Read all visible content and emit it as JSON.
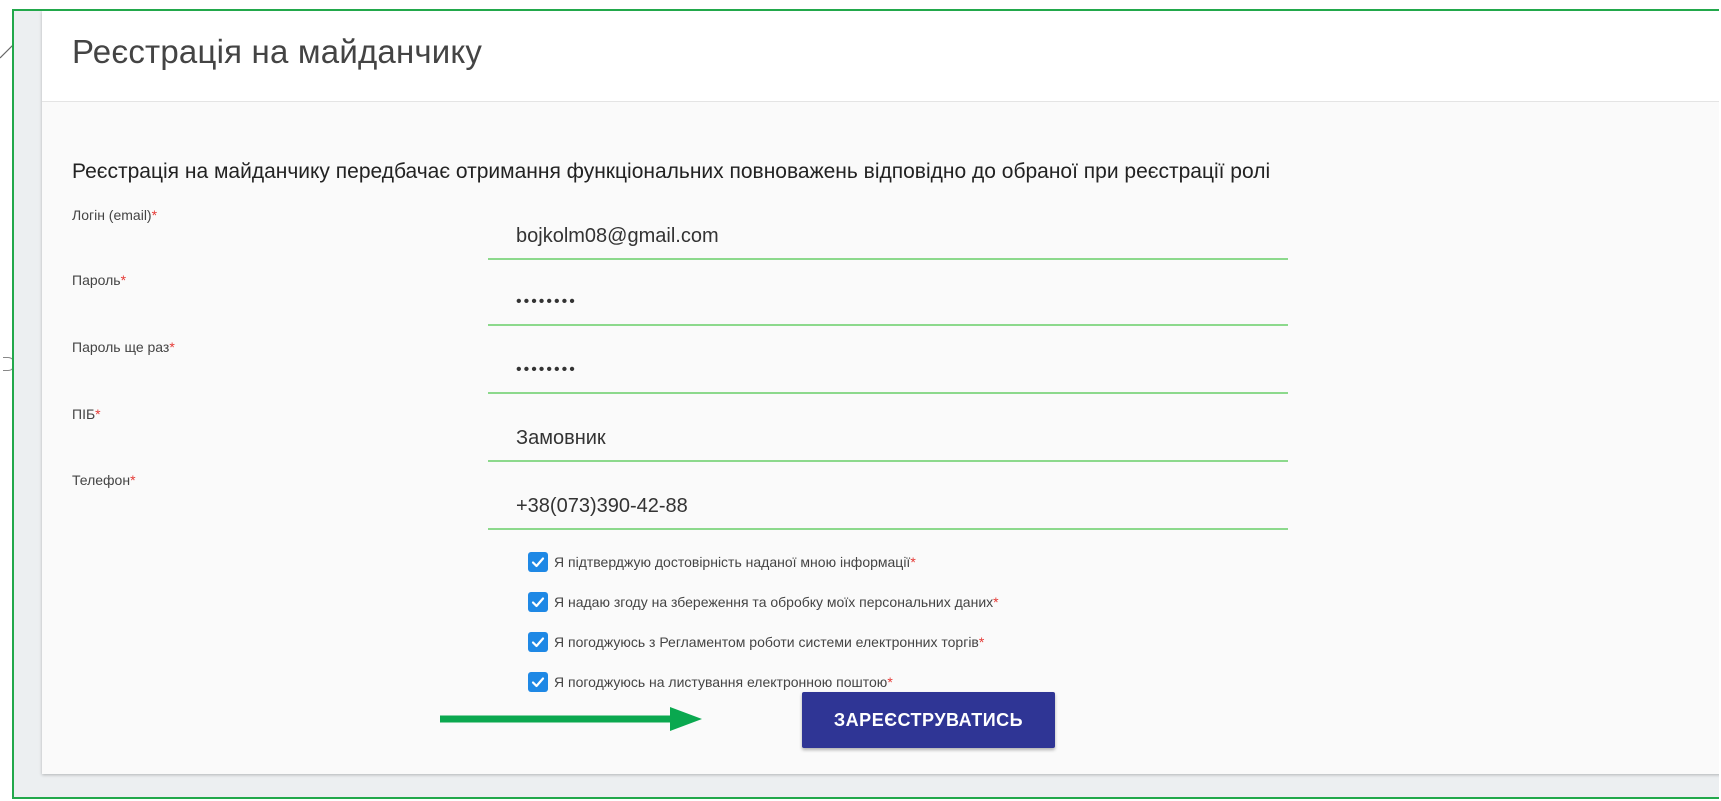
{
  "header": {
    "title": "Реєстрація на майданчику"
  },
  "form": {
    "intro": "Реєстрація на майданчику передбачає отримання функціональних повноважень відповідно до обраної при реєстрації ролі",
    "fields": [
      {
        "label": "Логін (email)",
        "required_mark": "*",
        "value": "bojkolm08@gmail.com"
      },
      {
        "label": "Пароль",
        "required_mark": "*",
        "value": "••••••••"
      },
      {
        "label": "Пароль ще раз",
        "required_mark": "*",
        "value": "••••••••"
      },
      {
        "label": "ПІБ",
        "required_mark": "*",
        "value": "Замовник"
      },
      {
        "label": "Телефон",
        "required_mark": "*",
        "value": "+38(073)390-42-88"
      }
    ],
    "checkboxes": [
      {
        "label": "Я підтверджую достовірність наданої мною інформації",
        "required_mark": "*",
        "checked": true
      },
      {
        "label": "Я надаю згоду на збереження та обробку моїх персональних даних",
        "required_mark": "*",
        "checked": true
      },
      {
        "label": "Я погоджуюсь з Регламентом роботи системи електронних торгів",
        "required_mark": "*",
        "checked": true
      },
      {
        "label": "Я погоджуюсь на листування електронною поштою",
        "required_mark": "*",
        "checked": true
      }
    ],
    "register_label": "ЗАРЕЄСТРУВАТИСЬ"
  },
  "icons": {
    "checkbox": "check-icon",
    "arrow": "arrow-right-icon"
  },
  "colors": {
    "frame_border": "#22a84b",
    "button_bg": "#2f3595",
    "input_underline": "#8cd98c",
    "checkbox_bg": "#1e88e5",
    "required": "#e53935",
    "arrow": "#0aa84f"
  }
}
